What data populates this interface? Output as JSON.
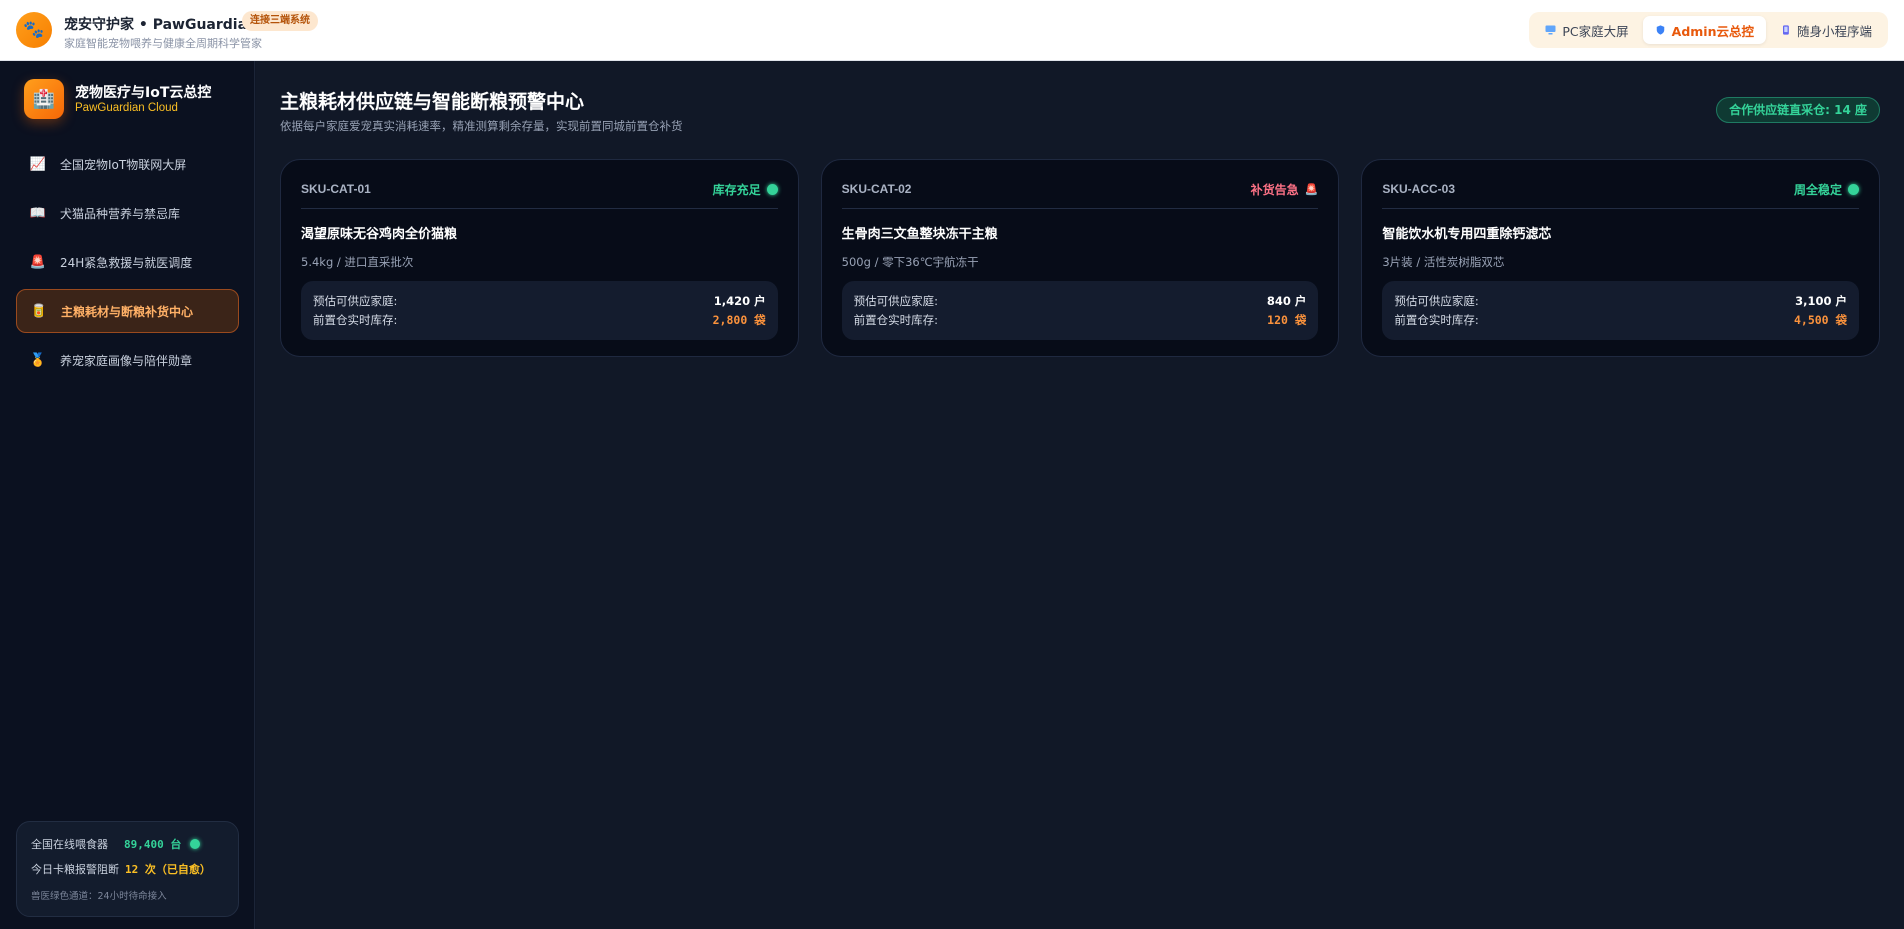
{
  "header": {
    "logo_icon": "paw-icon",
    "title": "宠安守护家 • PawGuardian",
    "badge": "连接三端系统",
    "subtitle": "家庭智能宠物喂养与健康全周期科学管家",
    "switcher": [
      {
        "icon": "monitor-icon",
        "label": "PC家庭大屏",
        "active": false
      },
      {
        "icon": "shield-icon",
        "label": "Admin云总控",
        "active": true
      },
      {
        "icon": "phone-icon",
        "label": "随身小程序端",
        "active": false
      }
    ]
  },
  "sidebar": {
    "logo_icon": "medical-kit-icon",
    "title": "宠物医疗与IoT云总控",
    "subtitle": "PawGuardian Cloud",
    "items": [
      {
        "icon": "chart-icon",
        "label": "全国宠物IoT物联网大屏",
        "active": false
      },
      {
        "icon": "book-icon",
        "label": "犬猫品种营养与禁忌库",
        "active": false
      },
      {
        "icon": "siren-icon",
        "label": "24H紧急救援与就医调度",
        "active": false
      },
      {
        "icon": "food-can-icon",
        "label": "主粮耗材与断粮补货中心",
        "active": true
      },
      {
        "icon": "medal-icon",
        "label": "养宠家庭画像与陪伴勋章",
        "active": false
      }
    ],
    "stats": {
      "feeders_label": "全国在线喂食器",
      "feeders_value": "89,400 台",
      "jams_label": "今日卡粮报警阻断",
      "jams_value": "12 次（已自愈）",
      "note": "兽医绿色通道：24小时待命接入"
    }
  },
  "main": {
    "title": "主粮耗材供应链与智能断粮预警中心",
    "subtitle": "依据每户家庭爱宠真实消耗速率，精准测算剩余存量，实现前置同城前置仓补货",
    "supply_pill": "合作供应链直采仓: 14 座",
    "cards": [
      {
        "sku": "SKU-CAT-01",
        "status": "库存充足",
        "status_type": "ok",
        "product": "渴望原味无谷鸡肉全价猫粮",
        "spec": "5.4kg / 进口直采批次",
        "households_label": "预估可供应家庭:",
        "households_value": "1,420 户",
        "stock_label": "前置仓实时库存:",
        "stock_value": "2,800 袋"
      },
      {
        "sku": "SKU-CAT-02",
        "status": "补货告急",
        "status_type": "warn",
        "product": "生骨肉三文鱼整块冻干主粮",
        "spec": "500g / 零下36℃宇航冻干",
        "households_label": "预估可供应家庭:",
        "households_value": "840 户",
        "stock_label": "前置仓实时库存:",
        "stock_value": "120 袋"
      },
      {
        "sku": "SKU-ACC-03",
        "status": "周全稳定",
        "status_type": "ok",
        "product": "智能饮水机专用四重除钙滤芯",
        "spec": "3片装 / 活性炭树脂双芯",
        "households_label": "预估可供应家庭:",
        "households_value": "3,100 户",
        "stock_label": "前置仓实时库存:",
        "stock_value": "4,500 袋"
      }
    ]
  },
  "colors": {
    "accent_orange": "#f76707",
    "ok_green": "#34d399",
    "warn_red": "#fb7185",
    "stock_orange": "#fb923c"
  }
}
